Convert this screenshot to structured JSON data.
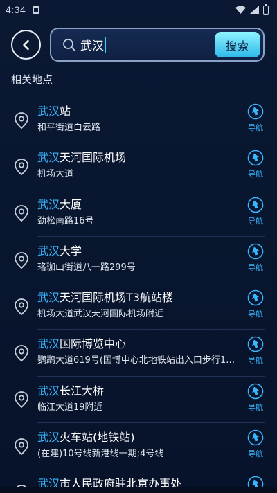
{
  "status_bar": {
    "time": "4:34"
  },
  "search": {
    "query": "武汉",
    "button_label": "搜索"
  },
  "section_title": "相关地点",
  "nav_label": "导航",
  "highlight_color": "#3ab6ff",
  "results": [
    {
      "highlight": "武汉",
      "rest": "站",
      "address": "和平街道白云路"
    },
    {
      "highlight": "武汉",
      "rest": "天河国际机场",
      "address": "机场大道"
    },
    {
      "highlight": "武汉",
      "rest": "大厦",
      "address": "劲松南路16号"
    },
    {
      "highlight": "武汉",
      "rest": "大学",
      "address": "珞珈山街道八一路299号"
    },
    {
      "highlight": "武汉",
      "rest": "天河国际机场T3航站楼",
      "address": "机场大道武汉天河国际机场附近"
    },
    {
      "highlight": "武汉",
      "rest": "国际博览中心",
      "address": "鹦鹉大道619号(国博中心北地铁站出入口步行150..."
    },
    {
      "highlight": "武汉",
      "rest": "长江大桥",
      "address": "临江大道19附近"
    },
    {
      "highlight": "武汉",
      "rest": "火车站(地铁站)",
      "address": "(在建)10号线新港线一期;4号线"
    },
    {
      "highlight": "武汉",
      "rest": "市人民政府驻北京办事处",
      "address": ""
    }
  ]
}
